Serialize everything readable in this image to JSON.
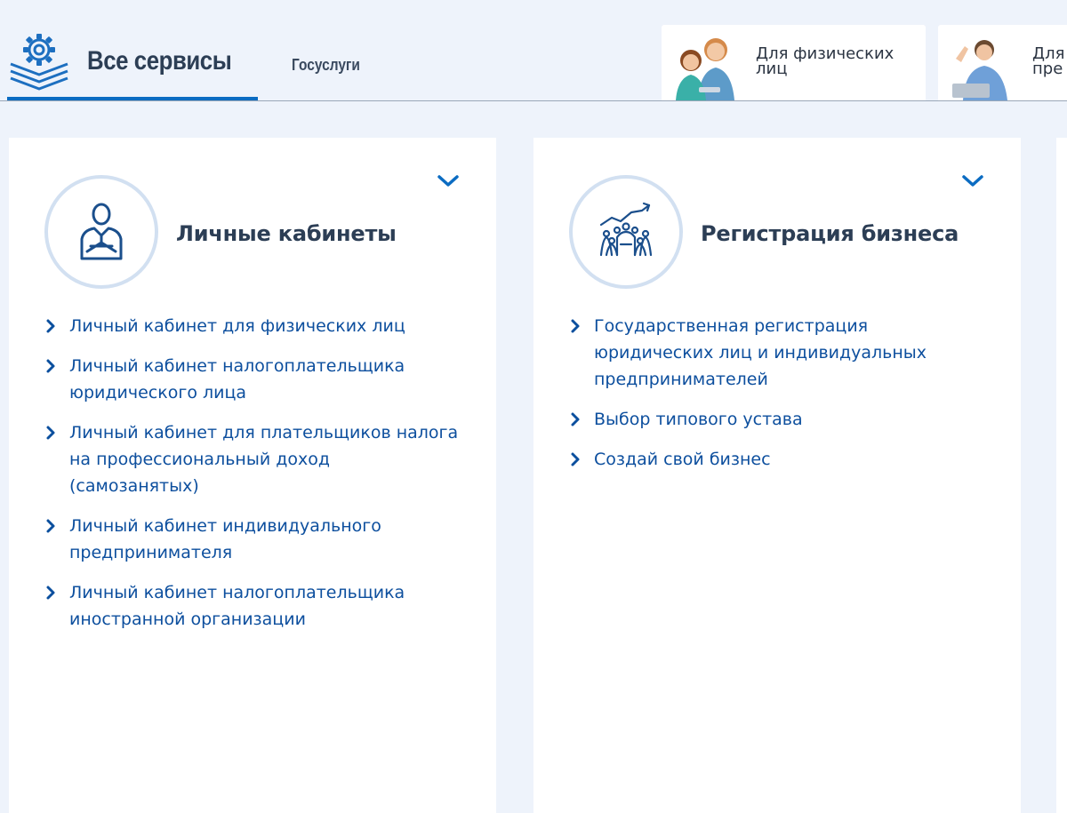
{
  "header": {
    "title": "Все сервисы",
    "breadcrumb": "Госуслуги",
    "audience_tabs": [
      {
        "label_line1": "Для физических",
        "label_line2": "лиц"
      },
      {
        "label_line1": "Для",
        "label_line2": "пре"
      }
    ]
  },
  "cards": [
    {
      "title": "Личные кабинеты",
      "links": [
        "Личный кабинет для физических лиц",
        "Личный кабинет налогоплательщика юридического лица",
        "Личный кабинет для плательщиков налога на профессиональный доход (самозанятых)",
        "Личный кабинет индивидуального предпринимателя",
        "Личный кабинет налогоплательщика иностранной организации"
      ]
    },
    {
      "title": "Регистрация бизнеса",
      "links": [
        "Государственная регистрация юридических лиц и индивидуальных предпринимателей",
        "Выбор типового устава",
        "Создай свой бизнес"
      ]
    }
  ],
  "icons": {
    "logo": "gear-layers-icon",
    "card1": "person-icon",
    "card2": "business-growth-icon",
    "expand": "chevron-down-icon",
    "link": "chevron-right-icon"
  },
  "colors": {
    "page_bg": "#eef3fb",
    "accent": "#0b6cc2",
    "link": "#0d4f9e",
    "title": "#2c3e55",
    "circle_border": "#d2e0f1"
  }
}
